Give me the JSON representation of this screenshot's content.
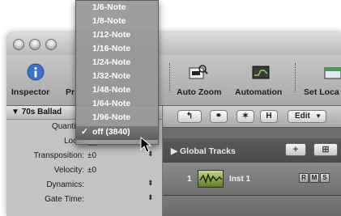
{
  "toolbar": {
    "items": [
      {
        "label": "Inspector",
        "icon": "info-icon"
      },
      {
        "label": "Pr",
        "icon": "preferences-icon"
      },
      {
        "label": "Auto Zoom",
        "icon": "auto-zoom-icon"
      },
      {
        "label": "Automation",
        "icon": "automation-icon"
      },
      {
        "label": "Set Loca",
        "icon": "set-locators-icon"
      }
    ]
  },
  "inspector": {
    "title": "70s Ballad",
    "rows": [
      {
        "label": "Quantize",
        "value": ""
      },
      {
        "label": "Loop:",
        "value": ""
      },
      {
        "label": "Transposition:",
        "value": "±0"
      },
      {
        "label": "Velocity:",
        "value": "±0"
      },
      {
        "label": "Dynamics:",
        "value": ""
      },
      {
        "label": "Gate Time:",
        "value": ""
      }
    ]
  },
  "menu": {
    "items": [
      "1/6-Note",
      "1/8-Note",
      "1/12-Note",
      "1/16-Note",
      "1/24-Note",
      "1/32-Note",
      "1/48-Note",
      "1/64-Note",
      "1/96-Note",
      "off (3840)"
    ],
    "selected_index": 9,
    "checkmark": "✓"
  },
  "arrange": {
    "edit_label": "Edit",
    "h_label": "H",
    "global_tracks": "Global Tracks",
    "track": {
      "number": "1",
      "name": "Inst 1",
      "buttons": [
        "R",
        "M",
        "S"
      ]
    }
  },
  "colors": {
    "menu_bg": "#969696",
    "menu_selected": "#666666",
    "track_region": "#7a9a3a"
  }
}
